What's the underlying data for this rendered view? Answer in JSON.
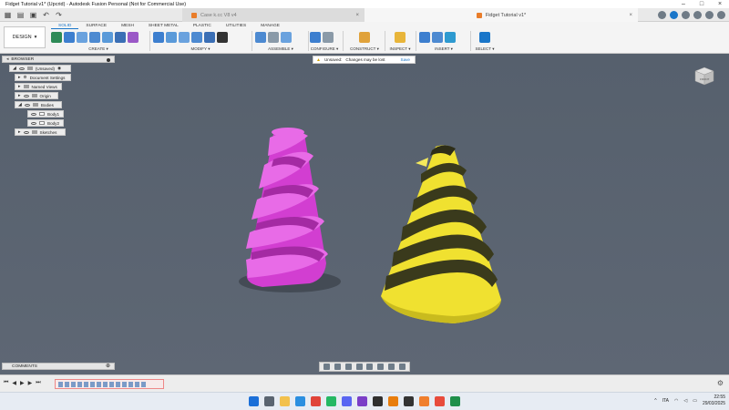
{
  "window": {
    "title": "Fidget Tutorial v1* (Upcrid) - Autodesk Fusion Personal (Not for Commercial Use)"
  },
  "tabs": {
    "inactive": "Case k.cc V8 v4",
    "active": "Fidget Tutorial v1*"
  },
  "ribbon": {
    "workspace": "DESIGN",
    "tabs": [
      "SOLID",
      "SURFACE",
      "MESH",
      "SHEET METAL",
      "PLASTIC",
      "UTILITIES",
      "MANAGE"
    ],
    "selected_tab": "SOLID",
    "groups": [
      "CREATE",
      "MODIFY",
      "ASSEMBLE",
      "CONFIGURE",
      "CONSTRUCT",
      "INSPECT",
      "INSERT",
      "SELECT"
    ]
  },
  "browser": {
    "title": "BROWSER",
    "root": "(Unsaved)",
    "items": [
      "Document Settings",
      "Named Views",
      "Origin",
      "Bodies",
      "Body1",
      "Body2",
      "Sketches"
    ]
  },
  "banner": {
    "status": "Unsaved:",
    "message": "Changes may be lost",
    "save": "Save"
  },
  "viewcube": {
    "label": "FRONT"
  },
  "comments": {
    "label": "COMMENTS"
  },
  "taskbar": {
    "language": "ITA",
    "time": "22:55",
    "date": "29/03/2025"
  },
  "colors": {
    "body1": "#e14ee0",
    "body2": "#f0e130",
    "accent": "#1a76c9"
  }
}
